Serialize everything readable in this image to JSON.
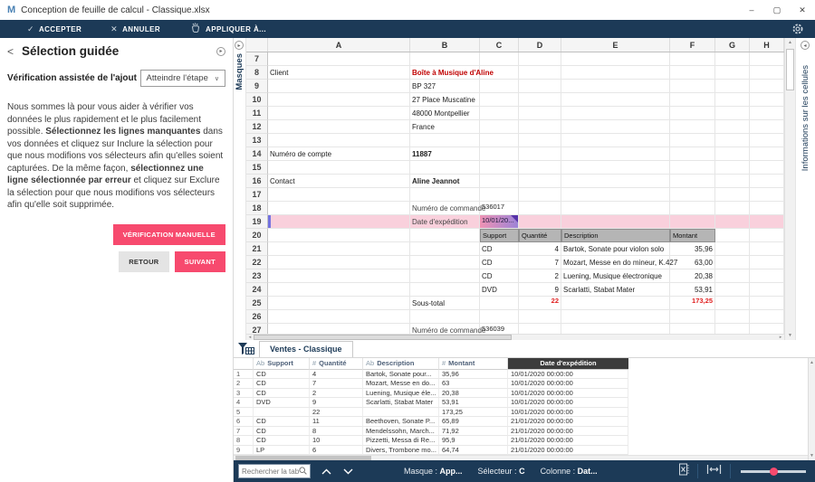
{
  "window": {
    "logo": "M",
    "title": "Conception de feuille de calcul - Classique.xlsx"
  },
  "icons": {
    "check": "✓",
    "close_x": "✕",
    "minimize": "–",
    "maximize": "▢",
    "window_close": "✕",
    "caret_down": "∨",
    "tri_up": "▲",
    "tri_down": "▼",
    "tri_left": "◂",
    "tri_right": "▸",
    "back_chevron": "<",
    "pin_arrow": "▸"
  },
  "colors": {
    "navy": "#1c3a57",
    "accent_pink": "#f74a6e",
    "client_red": "#c00000",
    "error_red": "#e02020",
    "row_highlight": "#f9d0dc",
    "selected_cell_gradient": [
      "#ef93b4",
      "#9d83d6"
    ],
    "selected_cell_corner": "#5632a8"
  },
  "toolbar": {
    "accept": "ACCEPTER",
    "cancel": "ANNULER",
    "apply_to": "APPLIQUER À..."
  },
  "guided_panel": {
    "title": "Sélection guidée",
    "assist_label": "Vérification assistée de l'ajout",
    "step_dropdown": "Atteindre l'étape",
    "paragraph": [
      {
        "text": "Nous sommes là pour vous aider à vérifier vos données le plus rapidement et le plus facilement possible. ",
        "bold": false
      },
      {
        "text": "Sélectionnez les lignes manquantes",
        "bold": true
      },
      {
        "text": " dans vos données et cliquez sur Inclure la sélection pour que nous modifions vos sélecteurs afin qu'elles soient capturées. De la même façon, ",
        "bold": false
      },
      {
        "text": "sélectionnez une ligne sélectionnée par erreur",
        "bold": true
      },
      {
        "text": " et cliquez sur Exclure la sélection pour que nous modifions vos sélecteurs afin qu'elle soit supprimée.",
        "bold": false
      }
    ],
    "buttons": {
      "manual": "VÉRIFICATION MANUELLE",
      "back": "RETOUR",
      "next": "SUIVANT"
    }
  },
  "side_tabs": {
    "left": "Masques",
    "right": "Informations sur les cellules"
  },
  "spreadsheet": {
    "columns": [
      "A",
      "B",
      "C",
      "D",
      "E",
      "F",
      "G",
      "H"
    ],
    "row_start": 7,
    "row_end": 27,
    "highlight_row": 19,
    "cells": {
      "A8": {
        "t": "Client"
      },
      "B8": {
        "t": "Boîte à Musique d'Aline",
        "c": "red"
      },
      "B9": {
        "t": "BP 327"
      },
      "B10": {
        "t": "27 Place Muscatine"
      },
      "B11": {
        "t": "48000 Montpellier"
      },
      "B12": {
        "t": "France"
      },
      "A14": {
        "t": "Numéro de compte"
      },
      "B14": {
        "t": "11887",
        "c": "b"
      },
      "A16": {
        "t": "Contact"
      },
      "B16": {
        "t": "Aline Jeannot",
        "c": "b"
      },
      "B18": {
        "t": "Numéro de commande",
        "c": "low"
      },
      "C18": {
        "t": "536017",
        "c": "tiny"
      },
      "B19": {
        "t": "Date d'expédition",
        "c": "low"
      },
      "C19": {
        "t": "10/01/20...",
        "c": "sel"
      },
      "C20": {
        "t": "Support",
        "c": "gh"
      },
      "D20": {
        "t": "Quantité",
        "c": "gh"
      },
      "E20": {
        "t": "Description",
        "c": "gh"
      },
      "F20": {
        "t": "Montant",
        "c": "gh"
      },
      "C21": {
        "t": "CD"
      },
      "D21": {
        "t": "4",
        "c": "r"
      },
      "E21": {
        "t": "Bartok, Sonate pour violon solo"
      },
      "F21": {
        "t": "35,96",
        "c": "r"
      },
      "C22": {
        "t": "CD"
      },
      "D22": {
        "t": "7",
        "c": "r"
      },
      "E22": {
        "t": "Mozart, Messe en do mineur, K.427"
      },
      "F22": {
        "t": "63,00",
        "c": "r"
      },
      "C23": {
        "t": "CD"
      },
      "D23": {
        "t": "2",
        "c": "r"
      },
      "E23": {
        "t": "Luening, Musique électronique"
      },
      "F23": {
        "t": "20,38",
        "c": "r"
      },
      "C24": {
        "t": "DVD"
      },
      "D24": {
        "t": "9",
        "c": "r"
      },
      "E24": {
        "t": "Scarlatti, Stabat Mater"
      },
      "F24": {
        "t": "53,91",
        "c": "r"
      },
      "B25": {
        "t": "Sous-total"
      },
      "D25": {
        "t": "22",
        "c": "rr"
      },
      "F25": {
        "t": "173,25",
        "c": "rr"
      },
      "B27": {
        "t": "Numéro de commande",
        "c": "low"
      },
      "C27": {
        "t": "536039",
        "c": "tiny"
      }
    }
  },
  "preview_table": {
    "tab": "Ventes - Classique",
    "headers": [
      {
        "prefix": "",
        "label": ""
      },
      {
        "prefix": "Ab",
        "label": "Support"
      },
      {
        "prefix": "#",
        "label": "Quantité"
      },
      {
        "prefix": "Ab",
        "label": "Description"
      },
      {
        "prefix": "#",
        "label": "Montant"
      },
      {
        "prefix": "",
        "label": "Date d'expédition",
        "selected": true
      }
    ],
    "rows": [
      [
        "1",
        "CD",
        "4",
        "Bartok, Sonate pour...",
        "35,96",
        "10/01/2020 00:00:00"
      ],
      [
        "2",
        "CD",
        "7",
        "Mozart, Messe en do...",
        "63",
        "10/01/2020 00:00:00"
      ],
      [
        "3",
        "CD",
        "2",
        "Luening, Musique éle...",
        "20,38",
        "10/01/2020 00:00:00"
      ],
      [
        "4",
        "DVD",
        "9",
        "Scarlatti, Stabat Mater",
        "53,91",
        "10/01/2020 00:00:00"
      ],
      [
        "5",
        "",
        "22",
        "",
        "173,25",
        "10/01/2020 00:00:00"
      ],
      [
        "6",
        "CD",
        "11",
        "Beethoven, Sonate P...",
        "65,89",
        "21/01/2020 00:00:00"
      ],
      [
        "7",
        "CD",
        "8",
        "Mendelssohn, March...",
        "71,92",
        "21/01/2020 00:00:00"
      ],
      [
        "8",
        "CD",
        "10",
        "Pizzetti, Messa di Re...",
        "95,9",
        "21/01/2020 00:00:00"
      ],
      [
        "9",
        "LP",
        "6",
        "Divers, Trombone mo...",
        "64,74",
        "21/01/2020 00:00:00"
      ]
    ]
  },
  "status_bar": {
    "search_placeholder": "Rechercher la table",
    "fields": [
      {
        "label": "Masque : ",
        "value": "App..."
      },
      {
        "label": "Sélecteur : ",
        "value": "C"
      },
      {
        "label": "Colonne : ",
        "value": "Dat..."
      }
    ]
  }
}
